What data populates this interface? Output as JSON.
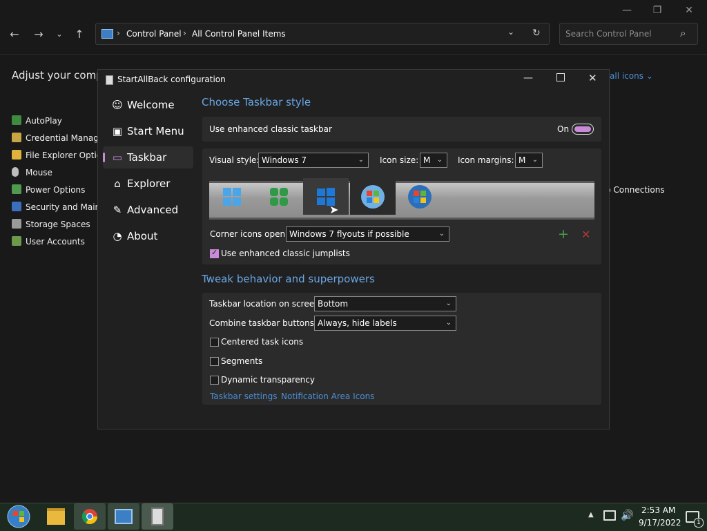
{
  "explorer": {
    "address": {
      "crumb1": "Control Panel",
      "crumb2": "All Control Panel Items"
    },
    "search_placeholder": "Search Control Panel",
    "heading_partial": "Adjust your comp",
    "view_link_partial": "all icons",
    "items": [
      "AutoPlay",
      "Credential Manager",
      "File Explorer Options",
      "Mouse",
      "Power Options",
      "Security and Mainte",
      "Storage Spaces",
      "User Accounts"
    ],
    "right_item_partial": "p Connections"
  },
  "dialog": {
    "title": "StartAllBack configuration",
    "sidebar": [
      {
        "icon": "☺",
        "label": "Welcome"
      },
      {
        "icon": "▣",
        "label": "Start Menu"
      },
      {
        "icon": "▭",
        "label": "Taskbar"
      },
      {
        "icon": "⌂",
        "label": "Explorer"
      },
      {
        "icon": "✎",
        "label": "Advanced"
      },
      {
        "icon": "◔",
        "label": "About"
      }
    ],
    "section1": {
      "heading": "Choose Taskbar style",
      "enhanced_label": "Use enhanced classic taskbar",
      "toggle_state": "On",
      "visual_style_label": "Visual style:",
      "visual_style_value": "Windows 7",
      "icon_size_label": "Icon size:",
      "icon_size_value": "M",
      "icon_margins_label": "Icon margins:",
      "icon_margins_value": "M",
      "corner_label": "Corner icons open:",
      "corner_value": "Windows 7 flyouts if possible",
      "jumplists_label": "Use enhanced classic jumplists",
      "jumplists_checked": true
    },
    "section2": {
      "heading": "Tweak behavior and superpowers",
      "location_label": "Taskbar location on screen:",
      "location_value": "Bottom",
      "combine_label": "Combine taskbar buttons:",
      "combine_value": "Always, hide labels",
      "centered_label": "Centered task icons",
      "segments_label": "Segments",
      "dynamic_label": "Dynamic transparency",
      "link_taskbar": "Taskbar settings",
      "link_notify": "Notification Area Icons"
    }
  },
  "taskbar": {
    "time": "2:53 AM",
    "date": "9/17/2022",
    "notification_count": "1"
  },
  "colors": {
    "accent": "#6aa6e6",
    "link": "#4c8fd6",
    "check": "#c98ad8",
    "add": "#3fa34d",
    "remove": "#b23a3a"
  }
}
